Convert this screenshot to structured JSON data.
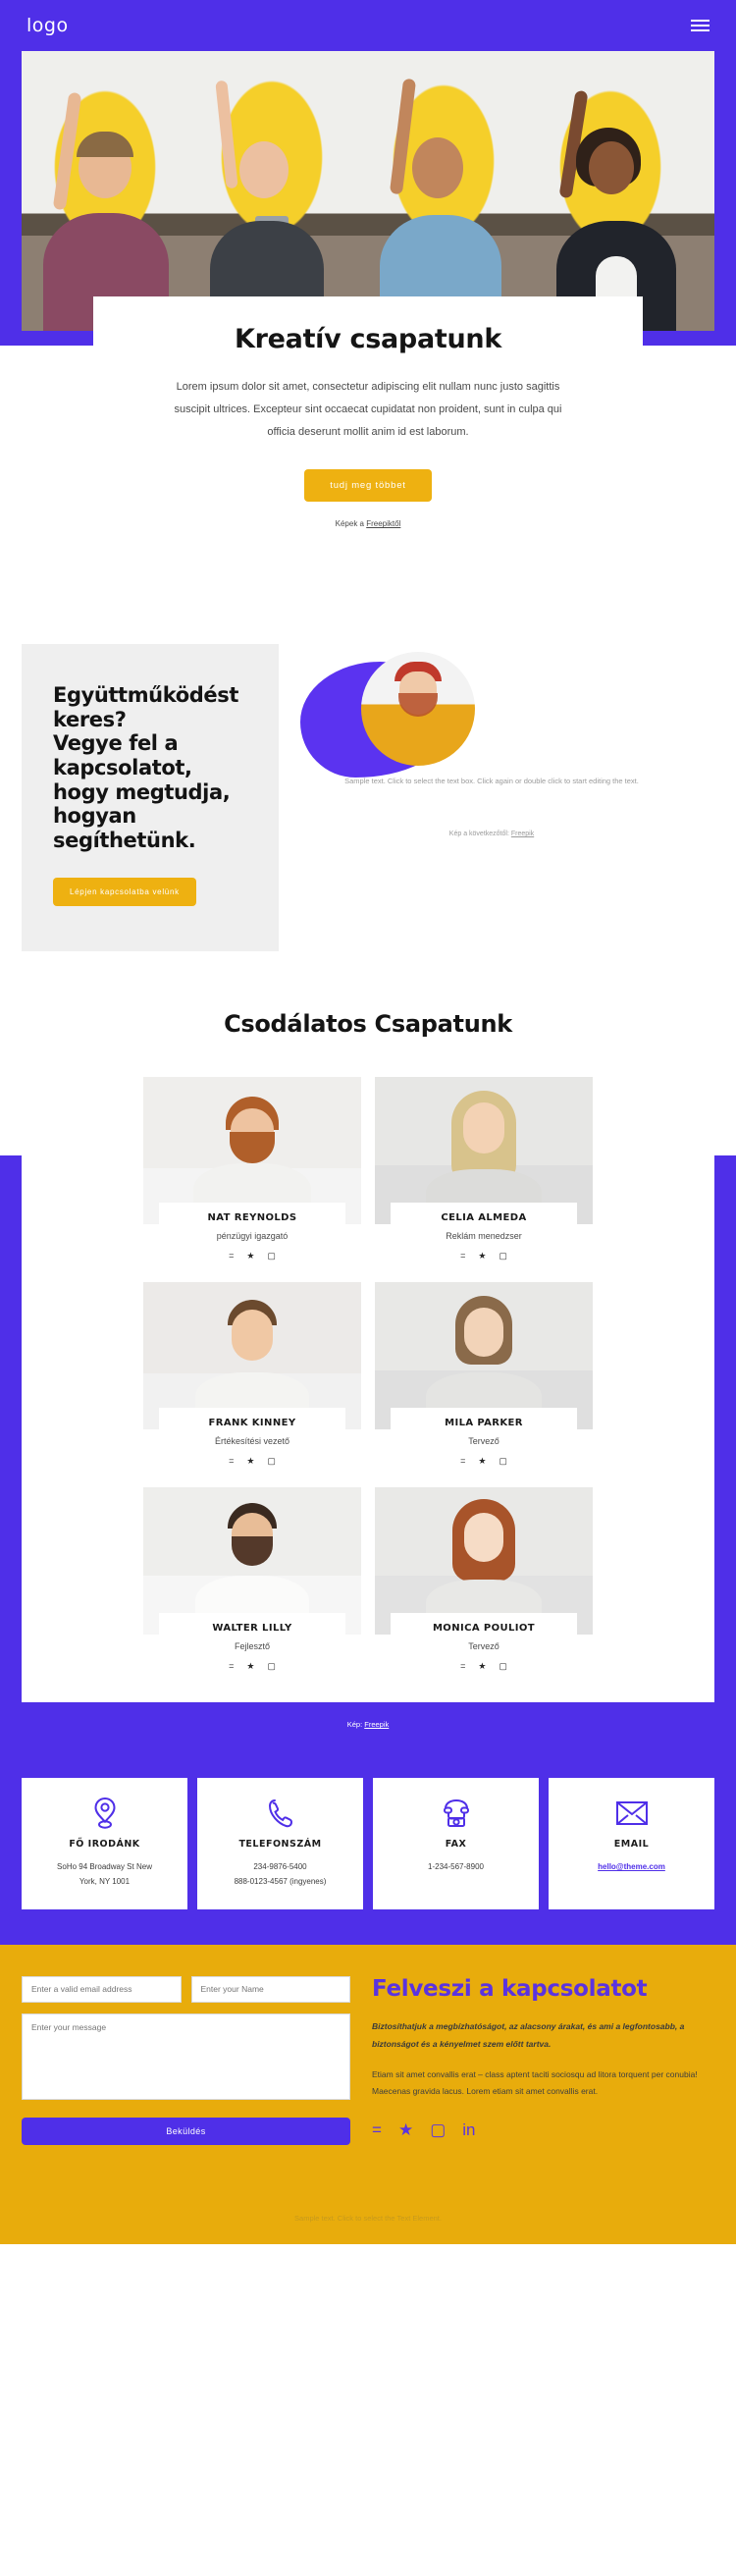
{
  "header": {
    "logo": "logo",
    "menu_icon": "hamburger-icon"
  },
  "hero": {
    "title": "Kreatív csapatunk",
    "paragraph": "Lorem ipsum dolor sit amet, consectetur adipiscing elit nullam nunc justo sagittis suscipit ultrices. Excepteur sint occaecat cupidatat non proident, sunt in culpa qui officia deserunt mollit anim id est laborum.",
    "button": "tudj meg többet",
    "credit_prefix": "Képek a ",
    "credit_link": "Freepiktől"
  },
  "collab": {
    "heading": "Együttműködést keres?\nVegye fel a kapcsolatot, hogy megtudja, hogyan segíthetünk.",
    "button": "Lépjen kapcsolatba velünk",
    "sample_text": "Sample text. Click to select the text box. Click again or double click to start editing the text.",
    "credit_prefix": "Kép a következőtől: ",
    "credit_link": "Freepik"
  },
  "team": {
    "title": "Csodálatos Csapatunk",
    "credit_prefix": "Kép: ",
    "credit_link": "Freepik",
    "members": [
      {
        "name": "NAT REYNOLDS",
        "role": "pénzügyi igazgató"
      },
      {
        "name": "CELIA ALMEDA",
        "role": "Reklám menedzser"
      },
      {
        "name": "FRANK KINNEY",
        "role": "Értékesítési vezető"
      },
      {
        "name": "MILA PARKER",
        "role": "Tervező"
      },
      {
        "name": "WALTER LILLY",
        "role": "Fejlesztő"
      },
      {
        "name": "MONICA POULIOT",
        "role": "Tervező"
      }
    ],
    "social_icons": [
      "facebook-icon",
      "twitter-icon",
      "instagram-icon"
    ]
  },
  "contact_info": [
    {
      "icon": "location-pin-icon",
      "label": "FŐ IRODÁNK",
      "line1": "SoHo 94 Broadway St New",
      "line2": "York, NY 1001",
      "is_link": false
    },
    {
      "icon": "phone-handset-icon",
      "label": "TELEFONSZÁM",
      "line1": "234-9876-5400",
      "line2": "888-0123-4567 (ingyenes)",
      "is_link": false
    },
    {
      "icon": "fax-icon",
      "label": "FAX",
      "line1": "1-234-567-8900",
      "line2": "",
      "is_link": false
    },
    {
      "icon": "envelope-icon",
      "label": "EMAIL",
      "line1": "hello@theme.com",
      "line2": "",
      "is_link": true
    }
  ],
  "form": {
    "email_placeholder": "Enter a valid email address",
    "name_placeholder": "Enter your Name",
    "message_placeholder": "Enter your message",
    "submit_label": "Beküldés"
  },
  "contact_text": {
    "heading": "Felveszi a kapcsolatot",
    "lead": "Biztosíthatjuk a megbízhatóságot, az alacsony árakat, és ami a legfontosabb, a biztonságot és a kényelmet szem előtt tartva.",
    "body": "Etiam sit amet convallis erat – class aptent taciti sociosqu ad litora torquent per conubia! Maecenas gravida lacus. Lorem etiam sit amet convallis erat.",
    "socials": [
      "facebook-icon",
      "twitter-icon",
      "instagram-icon",
      "linkedin-icon"
    ]
  },
  "footer": {
    "note": "Sample text. Click to select the Text Element."
  },
  "colors": {
    "purple": "#4f2fe8",
    "yellow": "#e8ac0c",
    "button_yellow": "#eeb111",
    "accent_purple": "#5b33e0"
  }
}
